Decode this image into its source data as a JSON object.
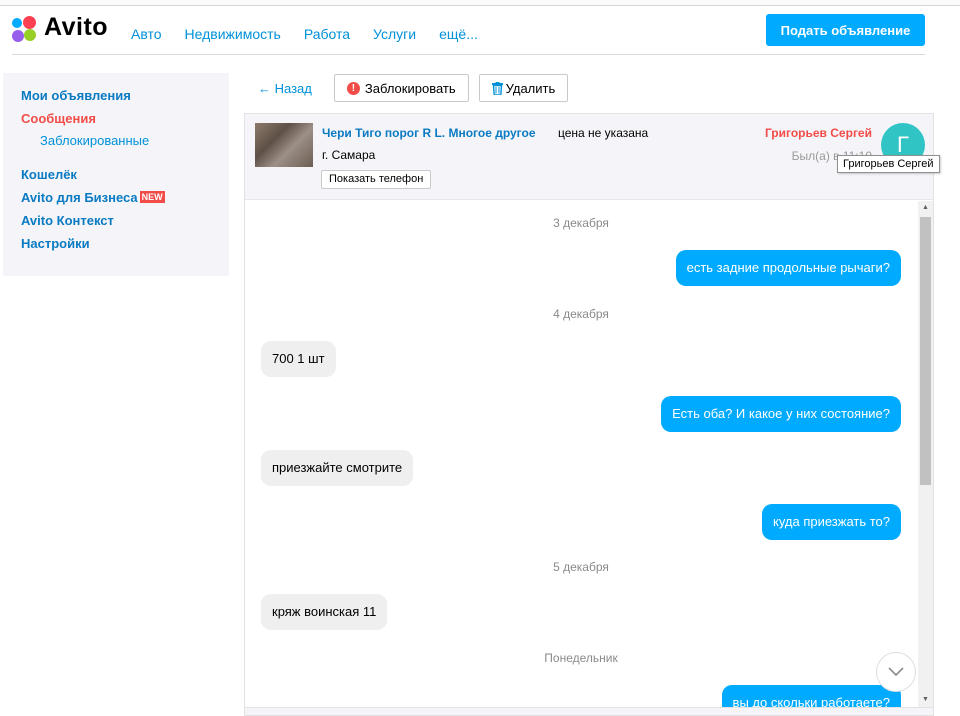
{
  "header": {
    "logo_text": "Avito",
    "nav": [
      "Авто",
      "Недвижимость",
      "Работа",
      "Услуги",
      "ещё..."
    ],
    "post_button": "Подать объявление"
  },
  "sidebar": {
    "my_ads": "Мои объявления",
    "messages": "Сообщения",
    "blocked": "Заблокированные",
    "wallet": "Кошелёк",
    "business": "Avito для Бизнеса",
    "new_badge": "NEW",
    "context": "Avito Контекст",
    "settings": "Настройки"
  },
  "toolbar": {
    "back": "← Назад",
    "block": "Заблокировать",
    "delete": "Удалить"
  },
  "chat_header": {
    "listing_title": "Чери Тиго порог R L. Многое другое",
    "price": "цена не указана",
    "city": "г. Самара",
    "show_phone": "Показать телефон",
    "seller": "Григорьев Сергей",
    "last_seen": "Был(а) в 11:10",
    "avatar_letter": "Г",
    "tooltip": "Григорьев Сергей"
  },
  "messages": {
    "date1": "3 декабря",
    "m1": "есть задние продольные рычаги?",
    "date2": "4 декабря",
    "m2": "700 1 шт",
    "m3": "Есть оба? И какое у них состояние?",
    "m4": "приезжайте смотрите",
    "m5": "куда приезжать то?",
    "date3": "5 декабря",
    "m6": "кряж воинская 11",
    "date4": "Понедельник",
    "m7": "вы до скольки работаете?"
  },
  "colors": {
    "accent": "#00aaff",
    "link": "#0091d9",
    "active": "#f14c47",
    "avatar": "#31c4c4"
  },
  "icons": [
    "alert-icon",
    "trash-icon",
    "chevron-down-icon"
  ]
}
